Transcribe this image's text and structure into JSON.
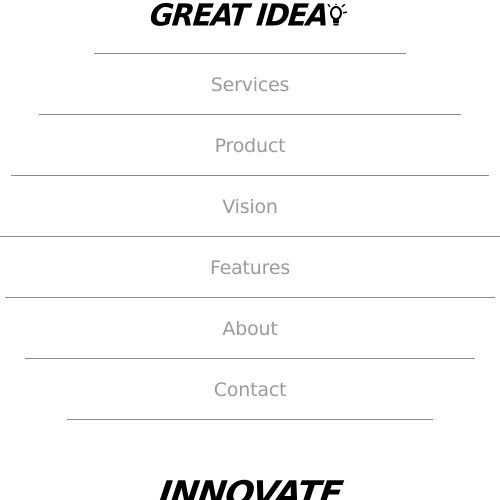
{
  "brand": {
    "logo_text": "GREAT IDEA",
    "icon": "lightbulb-icon"
  },
  "menu": {
    "items": [
      {
        "label": "Services"
      },
      {
        "label": "Product"
      },
      {
        "label": "Vision"
      },
      {
        "label": "Features"
      },
      {
        "label": "About"
      },
      {
        "label": "Contact"
      }
    ]
  },
  "footer": {
    "banner_text": "INNOVATE"
  },
  "colors": {
    "menu_text": "#9b9b9b",
    "divider": "#8a8a8a",
    "logo": "#000000",
    "background": "#ffffff"
  }
}
